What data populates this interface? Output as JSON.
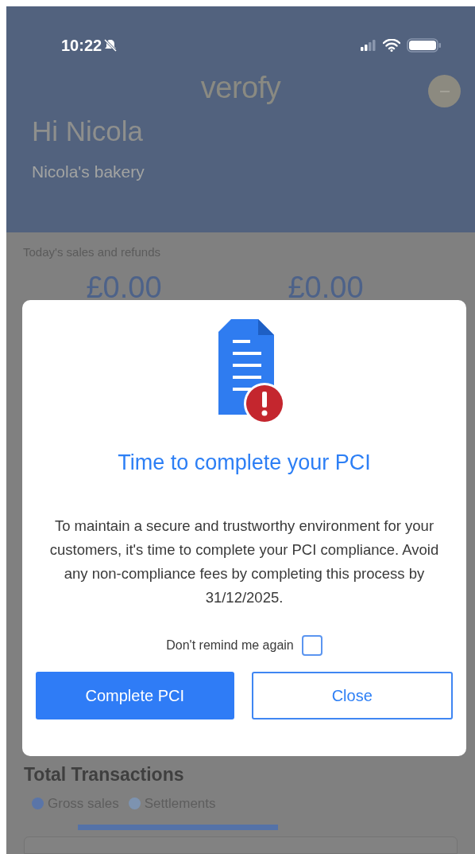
{
  "status_bar": {
    "time": "10:22"
  },
  "header": {
    "logo": "verofy",
    "greeting": "Hi Nicola",
    "business": "Nicola's bakery"
  },
  "sales": {
    "label": "Today's sales and refunds",
    "amounts": [
      "£0.00",
      "£0.00"
    ]
  },
  "transactions": {
    "title": "Total Transactions",
    "legend": [
      {
        "label": "Gross sales",
        "color": "#5a75a8"
      },
      {
        "label": "Settlements",
        "color": "#7d93b0"
      }
    ]
  },
  "dialog": {
    "title": "Time to complete your PCI",
    "message": "To maintain a secure and trustworthy environment for your customers, it's time to complete your PCI compliance. Avoid any non-compliance fees by completing this process by 31/12/2025.",
    "remind": {
      "label": "Don't remind me again",
      "checked": false
    },
    "buttons": [
      {
        "label": "Complete PCI",
        "kind": "primary"
      },
      {
        "label": "Close",
        "kind": "secondary"
      }
    ]
  }
}
